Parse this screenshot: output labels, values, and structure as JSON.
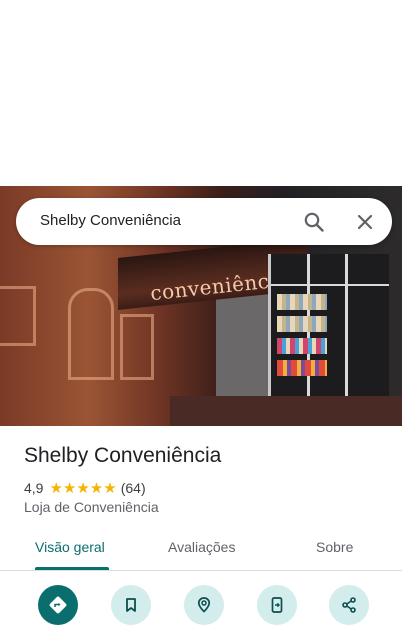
{
  "search": {
    "query": "Shelby Conveniência",
    "icons": [
      "search-icon",
      "close-icon"
    ]
  },
  "hero": {
    "awning_text": "conveniência"
  },
  "place": {
    "name": "Shelby Conveniência",
    "rating": "4,9",
    "stars": "★★★★★",
    "star_count": 5,
    "reviews": "(64)",
    "category": "Loja de Conveniência"
  },
  "tabs": [
    {
      "label": "Visão geral",
      "active": true
    },
    {
      "label": "Avaliações",
      "active": false
    },
    {
      "label": "Sobre",
      "active": false
    }
  ],
  "actions": [
    {
      "icon": "directions-icon"
    },
    {
      "icon": "bookmark-icon"
    },
    {
      "icon": "nearby-icon"
    },
    {
      "icon": "send-to-phone-icon"
    },
    {
      "icon": "share-icon"
    }
  ],
  "colors": {
    "accent": "#0b6e6e",
    "action_bg": "#d3ecec",
    "star": "#f4b400"
  }
}
